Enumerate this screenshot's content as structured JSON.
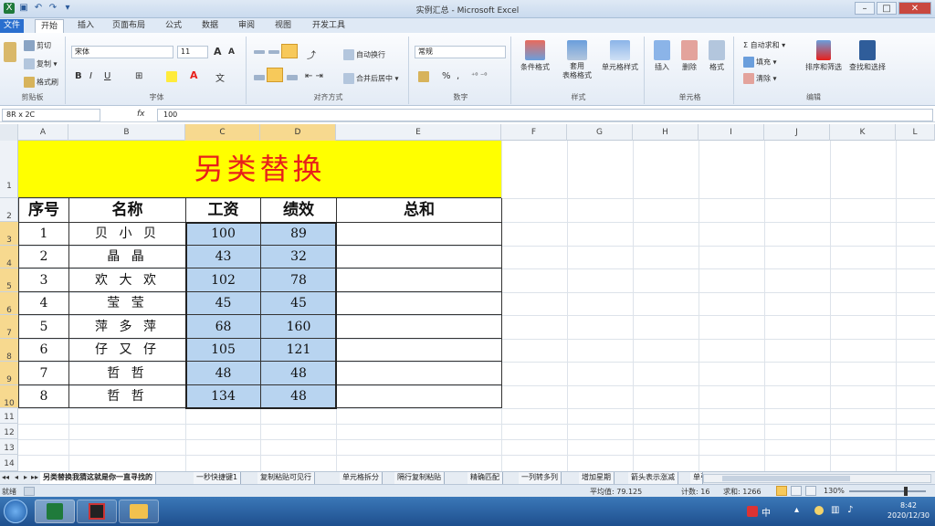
{
  "window": {
    "title": "实例汇总 - Microsoft Excel"
  },
  "tabs": [
    "文件",
    "开始",
    "插入",
    "页面布局",
    "公式",
    "数据",
    "审阅",
    "视图",
    "开发工具"
  ],
  "ribbon": {
    "clipboard": {
      "label": "剪贴板",
      "cut": "剪切",
      "copy": "复制 ▾",
      "format_painter": "格式刷",
      "paste": "粘贴"
    },
    "font": {
      "label": "字体",
      "font_name": "宋体",
      "font_size": "11",
      "grow": "A",
      "shrink": "A",
      "bold": "B",
      "italic": "I",
      "underline": "U",
      "font_color": "A",
      "phonetic": "文"
    },
    "alignment": {
      "label": "对齐方式",
      "wrap": "自动换行",
      "merge": "合并后居中 ▾"
    },
    "number": {
      "label": "数字",
      "format": "常规",
      "currency": "% ",
      "comma": ","
    },
    "styles": {
      "label": "样式",
      "conditional": "条件格式",
      "table": "套用\n表格格式",
      "cell_styles": "单元格样式"
    },
    "cells": {
      "label": "单元格",
      "insert": "插入",
      "delete": "删除",
      "format": "格式"
    },
    "editing": {
      "label": "编辑",
      "autosum": "Σ 自动求和 ▾",
      "fill": "填充 ▾",
      "clear": "清除 ▾",
      "sort": "排序和筛选",
      "find": "查找和选择"
    }
  },
  "formula_bar": {
    "name_box": "8R x 2C",
    "fx": "fx",
    "value": "100"
  },
  "columns": [
    "A",
    "B",
    "C",
    "D",
    "E",
    "F",
    "G",
    "H",
    "I",
    "J",
    "K",
    "L"
  ],
  "rows": [
    "1",
    "2",
    "3",
    "4",
    "5",
    "6",
    "7",
    "8",
    "9",
    "10",
    "11",
    "12",
    "13",
    "14"
  ],
  "sheet": {
    "title": "另类替换",
    "headers": {
      "seq": "序号",
      "name": "名称",
      "salary": "工资",
      "perf": "绩效",
      "total": "总和"
    },
    "records": [
      {
        "seq": "1",
        "name": "贝 小 贝",
        "salary": "100",
        "perf": "89"
      },
      {
        "seq": "2",
        "name": "晶 晶",
        "salary": "43",
        "perf": "32"
      },
      {
        "seq": "3",
        "name": "欢 大 欢",
        "salary": "102",
        "perf": "78"
      },
      {
        "seq": "4",
        "name": "莹 莹",
        "salary": "45",
        "perf": "45"
      },
      {
        "seq": "5",
        "name": "萍 多 萍",
        "salary": "68",
        "perf": "160"
      },
      {
        "seq": "6",
        "name": "仔 又 仔",
        "salary": "105",
        "perf": "121"
      },
      {
        "seq": "7",
        "name": "哲 哲",
        "salary": "48",
        "perf": "48"
      },
      {
        "seq": "8",
        "name": "哲 哲",
        "salary": "134",
        "perf": "48"
      }
    ]
  },
  "sheet_tabs": [
    "另类替换我猜这就是你一直寻找的",
    "一秒快捷键1",
    "复制粘贴可见行",
    "单元格拆分",
    "隔行复制粘贴",
    "精确匹配",
    "一列转多列",
    "增加星期",
    "箭头表示涨减",
    "单引"
  ],
  "status": {
    "ready": "就绪",
    "average": "平均值: 79.125",
    "count": "计数: 16",
    "sum": "求和: 1266",
    "zoom": "130%"
  },
  "taskbar": {
    "time": "8:42",
    "date": "2020/12/30",
    "ime": "中"
  }
}
